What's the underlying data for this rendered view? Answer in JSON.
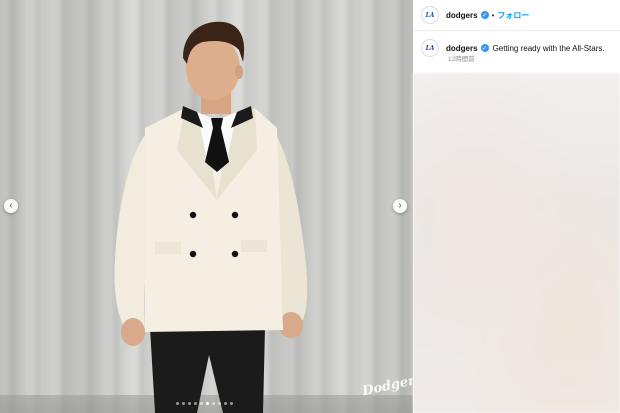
{
  "post": {
    "username": "dodgers",
    "follow_label": "フォロー",
    "separator": "•",
    "avatar_text": "LA",
    "caption": "Getting ready with the All-Stars.",
    "timestamp": "12時間前"
  },
  "photo": {
    "watermark": "Dodgers",
    "carousel": {
      "total": 10,
      "active_index": 5
    },
    "prev_arrow": "‹",
    "next_arrow": "›"
  },
  "colors": {
    "accent": "#0095f6",
    "verified": "#3897f0",
    "jacket": "#f4efe2",
    "trousers": "#1b1b1b"
  }
}
